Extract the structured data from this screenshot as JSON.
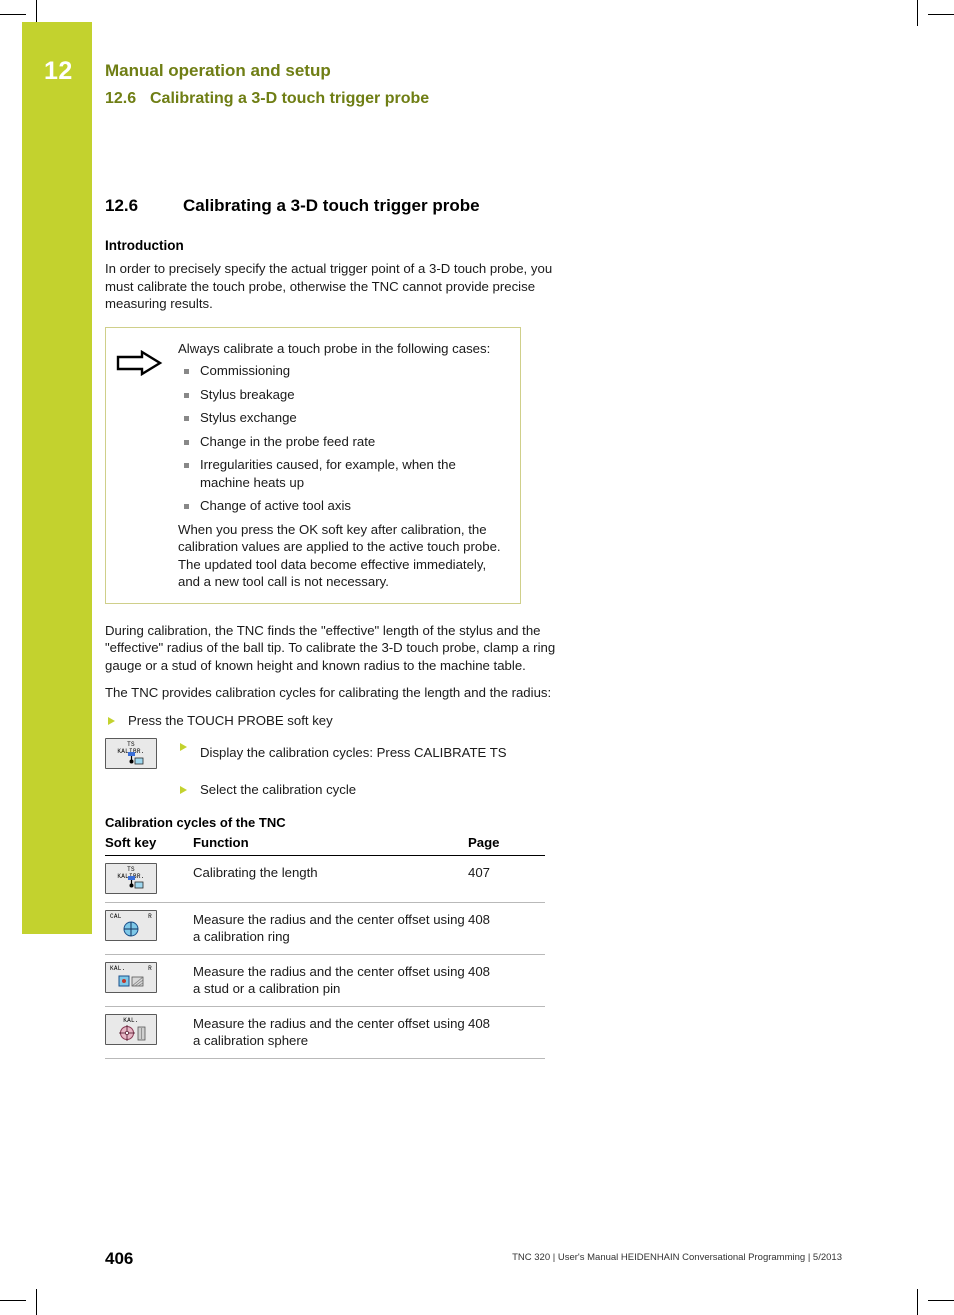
{
  "chapter": {
    "number": "12",
    "title": "Manual operation and setup",
    "subsection_number": "12.6",
    "subsection_title": "Calibrating a 3-D touch trigger probe"
  },
  "section": {
    "number": "12.6",
    "title": "Calibrating a 3-D touch trigger probe",
    "intro_heading": "Introduction",
    "intro_paragraph": "In order to precisely specify the actual trigger point of a 3-D touch probe, you must calibrate the touch probe, otherwise the TNC cannot provide precise measuring results."
  },
  "note": {
    "icon": "arrow-right-icon",
    "lead": "Always calibrate a touch probe in the following cases:",
    "bullets": [
      "Commissioning",
      "Stylus breakage",
      "Stylus exchange",
      "Change in the probe feed rate",
      "Irregularities caused, for example, when the machine heats up",
      "Change of active tool axis"
    ],
    "tail": "When you press the OK soft key after calibration, the calibration values are applied to the active touch probe. The updated tool data become effective immediately, and a new tool call is not necessary."
  },
  "body": {
    "p1": "During calibration, the TNC finds the \"effective\" length of the stylus and the \"effective\" radius of the ball tip. To calibrate the 3-D touch probe, clamp a ring gauge or a stud of known height and known radius to the machine table.",
    "p2": "The TNC provides calibration cycles for calibrating the length and the radius:",
    "step1": "Press the TOUCH PROBE soft key",
    "step2": "Display the calibration cycles: Press CALIBRATE TS",
    "step3": "Select the calibration cycle"
  },
  "softkeys": {
    "touch_probe": {
      "line1": "TS",
      "line2": "KALIBR."
    },
    "cal_ring": {
      "line1": "CAL",
      "line2": "R"
    },
    "cal_stud": {
      "line1": "KAL.",
      "line2": "R"
    },
    "cal_sphere": {
      "line1": "KAL."
    }
  },
  "table": {
    "title": "Calibration cycles of the TNC",
    "columns": [
      "Soft key",
      "Function",
      "Page"
    ],
    "rows": [
      {
        "function": "Calibrating the length",
        "page": "407"
      },
      {
        "function": "Measure the radius and the center offset using a calibration ring",
        "page": "408"
      },
      {
        "function": "Measure the radius and the center offset using a stud or a calibration pin",
        "page": "408"
      },
      {
        "function": "Measure the radius and the center offset using a calibration sphere",
        "page": "408"
      }
    ]
  },
  "footer": {
    "page_number": "406",
    "text": "TNC 320 | User's Manual HEIDENHAIN Conversational Programming | 5/2013"
  }
}
